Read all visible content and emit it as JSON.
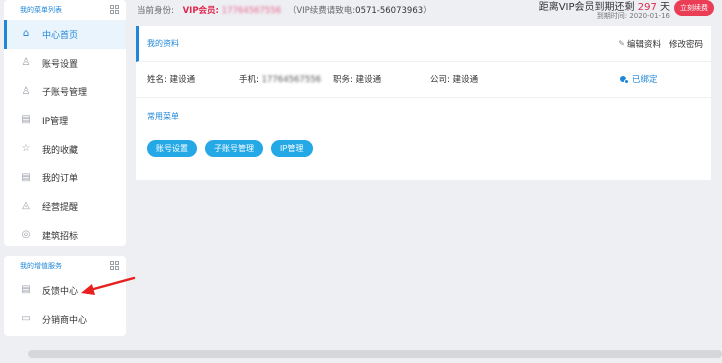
{
  "sidebar": {
    "menu_title": "我的菜单列表",
    "items": [
      {
        "label": "中心首页",
        "icon": "home-icon",
        "glyph": "⌂",
        "active": true
      },
      {
        "label": "账号设置",
        "icon": "user-icon",
        "glyph": "♙"
      },
      {
        "label": "子账号管理",
        "icon": "sub-user-icon",
        "glyph": "♙"
      },
      {
        "label": "IP管理",
        "icon": "document-icon",
        "glyph": "▤"
      },
      {
        "label": "我的收藏",
        "icon": "star-icon",
        "glyph": "☆"
      },
      {
        "label": "我的订单",
        "icon": "order-icon",
        "glyph": "▤"
      },
      {
        "label": "经营提醒",
        "icon": "bell-icon",
        "glyph": "◬"
      },
      {
        "label": "建筑招标",
        "icon": "target-icon",
        "glyph": "◎"
      }
    ],
    "service_title": "我的增值服务",
    "service_items": [
      {
        "label": "反馈中心",
        "icon": "feedback-icon",
        "glyph": "▤"
      },
      {
        "label": "分销商中心",
        "icon": "distributor-icon",
        "glyph": "▭"
      }
    ]
  },
  "top": {
    "identity_label": "当前身份:",
    "vip_label": "VIP会员:",
    "phone_masked": "17764567556",
    "renew_note_prefix": "（VIP续费请致电:",
    "hotline": "0571-56073963",
    "renew_note_suffix": "）",
    "expire_prefix": "距离VIP会员到期还剩",
    "expire_days": "297",
    "expire_suffix": "天",
    "expire_date_label": "到期时间:",
    "expire_date": "2020-01-16",
    "renew_button": "立刻续费"
  },
  "profile": {
    "title": "我的资料",
    "edit_label": "编辑资料",
    "change_password_label": "修改密码",
    "name_key": "姓名:",
    "name_value": "建设通",
    "phone_key": "手机:",
    "phone_value": "17764567556",
    "job_key": "职务:",
    "job_value": "建设通",
    "company_key": "公司:",
    "company_value": "建设通",
    "bound_label": "已绑定"
  },
  "common_menu": {
    "title": "常用菜单",
    "buttons": [
      "账号设置",
      "子账号管理",
      "IP管理"
    ]
  },
  "colors": {
    "accent": "#1f86d8",
    "vip_red": "#e0284f",
    "button_blue": "#24a9e6",
    "arrow_red": "#e8201f"
  }
}
